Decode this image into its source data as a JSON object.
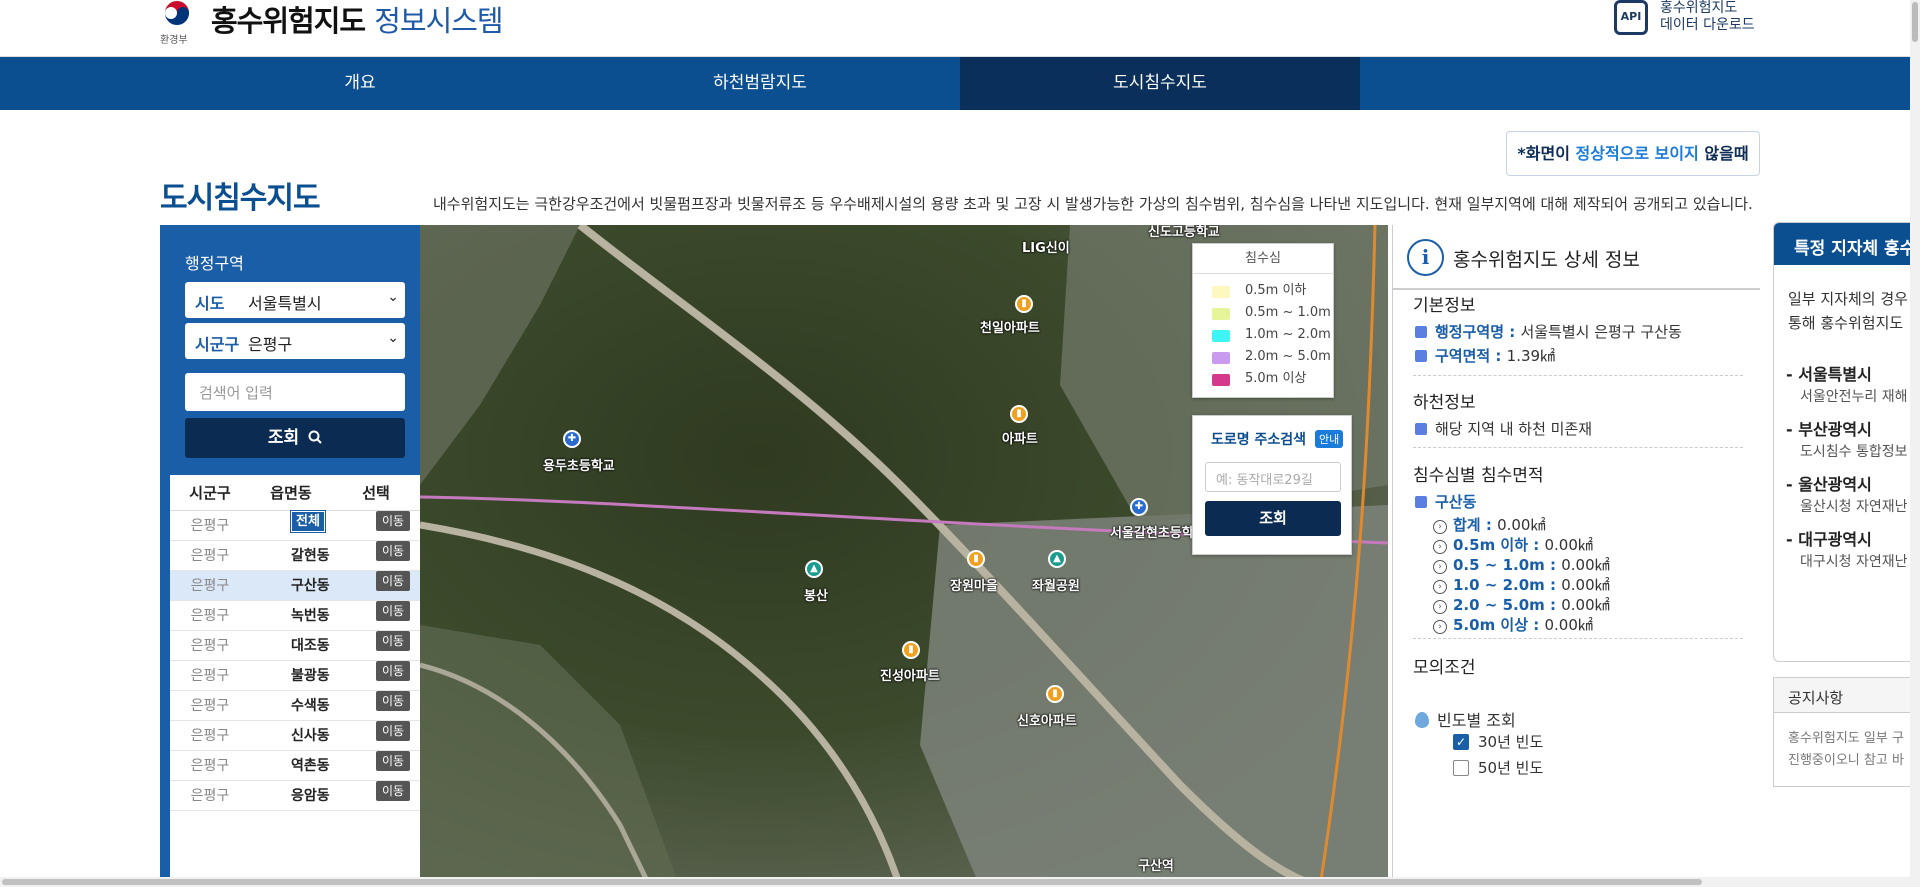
{
  "header": {
    "ministry": "환경부",
    "title_main": "홍수위험지도",
    "title_sub": "정보시스템",
    "api_badge": "API",
    "api_line1": "홍수위험지도",
    "api_line2": "데이터 다운로드"
  },
  "nav": {
    "items": [
      "개요",
      "하천범람지도",
      "도시침수지도"
    ],
    "active": "도시침수지도"
  },
  "notice_btn": {
    "pre": "*화면이 ",
    "highlight": "정상적으로 보이지",
    "post": " 않을때"
  },
  "page": {
    "title": "도시침수지도",
    "desc": "내수위험지도는 극한강우조건에서 빗물펌프장과 빗물저류조 등 우수배제시설의 용량 초과 및 고장 시 발생가능한 가상의 침수범위, 침수심을 나타낸 지도입니다. 현재 일부지역에 대해 제작되어 공개되고 있습니다."
  },
  "left": {
    "region_label": "행정구역",
    "sido_key": "시도",
    "sido_value": "서울특별시",
    "sigungu_key": "시군구",
    "sigungu_value": "은평구",
    "search_placeholder": "검색어 입력",
    "search_button": "조회",
    "table_headers": [
      "시군구",
      "읍면동",
      "선택"
    ],
    "rows": [
      {
        "sigungu": "은평구",
        "dong": "전체",
        "action": "이동",
        "is_all": true
      },
      {
        "sigungu": "은평구",
        "dong": "갈현동",
        "action": "이동"
      },
      {
        "sigungu": "은평구",
        "dong": "구산동",
        "action": "이동",
        "selected": true
      },
      {
        "sigungu": "은평구",
        "dong": "녹번동",
        "action": "이동"
      },
      {
        "sigungu": "은평구",
        "dong": "대조동",
        "action": "이동"
      },
      {
        "sigungu": "은평구",
        "dong": "불광동",
        "action": "이동"
      },
      {
        "sigungu": "은평구",
        "dong": "수색동",
        "action": "이동"
      },
      {
        "sigungu": "은평구",
        "dong": "신사동",
        "action": "이동"
      },
      {
        "sigungu": "은평구",
        "dong": "역촌동",
        "action": "이동"
      },
      {
        "sigungu": "은평구",
        "dong": "응암동",
        "action": "이동"
      }
    ]
  },
  "map": {
    "labels": [
      "용두초등학교",
      "봉산",
      "장원마을",
      "좌월공원",
      "천일아파트",
      "아파트",
      "진성아파트",
      "신호아파트",
      "서울갈현초등학교",
      "구산역",
      "신도고등학교",
      "LIG신이"
    ],
    "legend": {
      "title": "침수심",
      "items": [
        {
          "label": "0.5m 이하",
          "color": "#fdf7c0"
        },
        {
          "label": "0.5m ~ 1.0m",
          "color": "#e6f59a"
        },
        {
          "label": "1.0m ~ 2.0m",
          "color": "#3ff4f4"
        },
        {
          "label": "2.0m ~ 5.0m",
          "color": "#c99af0"
        },
        {
          "label": "5.0m 이상",
          "color": "#d6398a"
        }
      ]
    },
    "address_search": {
      "title": "도로명 주소검색",
      "guide": "안내",
      "placeholder": "예: 동작대로29길",
      "button": "조회"
    }
  },
  "detail": {
    "title": "홍수위험지도 상세 정보",
    "basic_title": "기본정보",
    "admin_key": "행정구역명",
    "admin_value": "서울특별시 은평구 구산동",
    "area_key": "구역면적",
    "area_value": "1.39㎢",
    "river_title": "하천정보",
    "river_value": "해당 지역 내 하천 미존재",
    "depth_title": "침수심별 침수면적",
    "depth_dong": "구산동",
    "depth_rows": [
      {
        "k": "합계",
        "v": "0.00㎢"
      },
      {
        "k": "0.5m 이하",
        "v": "0.00㎢"
      },
      {
        "k": "0.5 ~ 1.0m",
        "v": "0.00㎢"
      },
      {
        "k": "1.0 ~ 2.0m",
        "v": "0.00㎢"
      },
      {
        "k": "2.0 ~ 5.0m",
        "v": "0.00㎢"
      },
      {
        "k": "5.0m 이상",
        "v": "0.00㎢"
      }
    ],
    "sim_title": "모의조건",
    "freq_title": "빈도별 조회",
    "freq_30": "30년 빈도",
    "freq_50": "50년 빈도"
  },
  "side": {
    "title": "특정 지자체 홍수",
    "desc1": "일부 지자체의 경우",
    "desc2": "통해 홍수위험지도",
    "cities": [
      {
        "name": "서울특별시",
        "sub": "서울안전누리 재해"
      },
      {
        "name": "부산광역시",
        "sub": "도시침수 통합정보"
      },
      {
        "name": "울산광역시",
        "sub": "울산시청 자연재난"
      },
      {
        "name": "대구광역시",
        "sub": "대구시청 자연재난"
      }
    ]
  },
  "notice": {
    "title": "공지사항",
    "line1": "홍수위험지도 일부 구",
    "line2": "진행중이오니 참고 바"
  }
}
